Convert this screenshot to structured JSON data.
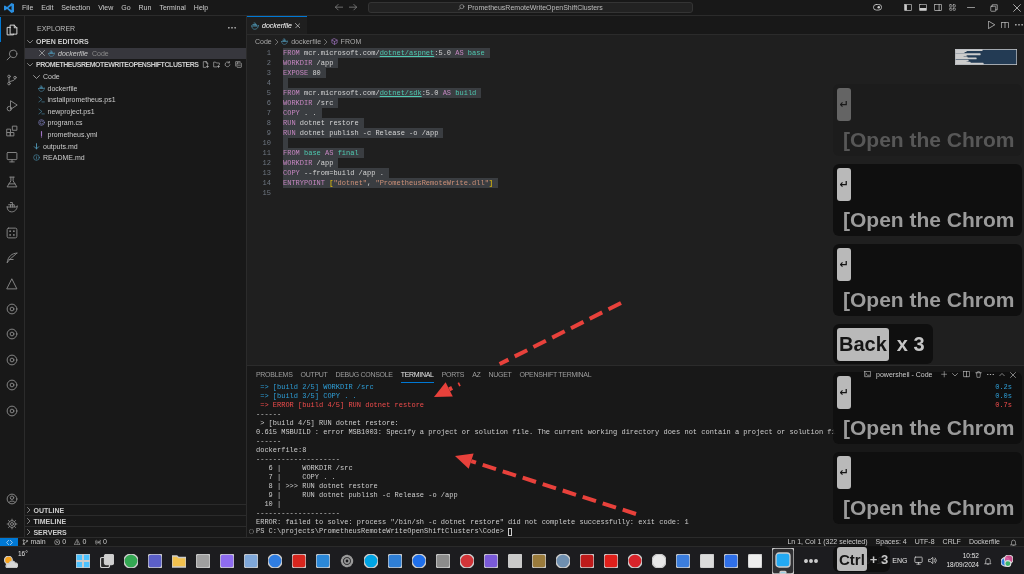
{
  "title_bar": {
    "menu": [
      "File",
      "Edit",
      "Selection",
      "View",
      "Go",
      "Run",
      "Terminal",
      "Help"
    ],
    "command_center": "PrometheusRemoteWriteOpenShiftClusters"
  },
  "activity_bar": {
    "items": [
      {
        "kind": "files",
        "selected": true
      },
      {
        "kind": "search",
        "selected": false
      },
      {
        "kind": "branch",
        "selected": false
      },
      {
        "kind": "debug",
        "selected": false
      },
      {
        "kind": "blocks",
        "selected": false
      },
      {
        "kind": "monitor",
        "selected": false
      },
      {
        "kind": "flask",
        "selected": false
      },
      {
        "kind": "whale",
        "selected": false
      },
      {
        "kind": "grid",
        "selected": false
      },
      {
        "kind": "feather",
        "selected": false
      },
      {
        "kind": "triangle",
        "selected": false
      },
      {
        "kind": "ring",
        "selected": false
      },
      {
        "kind": "ring",
        "selected": false
      },
      {
        "kind": "ring",
        "selected": false
      },
      {
        "kind": "ring",
        "selected": false
      },
      {
        "kind": "ring",
        "selected": false
      }
    ],
    "bottom": [
      {
        "kind": "account"
      },
      {
        "kind": "gear"
      }
    ]
  },
  "sidebar": {
    "title": "EXPLORER",
    "open_editors": {
      "label": "OPEN EDITORS",
      "expanded": true,
      "items": [
        {
          "name": "dockerfile",
          "detail": "Code",
          "kind": "docker",
          "selected": true,
          "preview": true
        }
      ]
    },
    "workspace": {
      "label": "PROMETHEUSREMOTEWRITEOPENSHIFTCLUSTERS",
      "expanded": true,
      "tree": [
        {
          "name": "Code",
          "kind": "folder",
          "expanded": true,
          "selected": false,
          "children": [
            {
              "name": "dockerfile",
              "kind": "docker",
              "selected": false
            },
            {
              "name": "installprometheus.ps1",
              "kind": "powershell",
              "selected": false
            },
            {
              "name": "newproject.ps1",
              "kind": "powershell",
              "selected": false
            },
            {
              "name": "program.cs",
              "kind": "csharp",
              "selected": false
            },
            {
              "name": "prometheus.yml",
              "kind": "yaml",
              "selected": false
            }
          ]
        },
        {
          "name": "outputs.md",
          "kind": "markdown",
          "selected": false
        },
        {
          "name": "README.md",
          "kind": "info",
          "selected": false
        }
      ]
    },
    "sections": [
      {
        "label": "OUTLINE",
        "expanded": false
      },
      {
        "label": "TIMELINE",
        "expanded": false
      },
      {
        "label": "SERVERS",
        "expanded": false
      }
    ]
  },
  "editor": {
    "tabs": [
      {
        "label": "dockerfile",
        "kind": "docker",
        "selected": true,
        "preview": true
      }
    ],
    "breadcrumb": [
      {
        "label": "Code",
        "kind": "folder"
      },
      {
        "label": "dockerfile",
        "kind": "docker"
      },
      {
        "label": "FROM",
        "kind": "symbol"
      }
    ],
    "lines": [
      {
        "number": "1",
        "selected": true,
        "tokens": [
          {
            "kind": "keyword",
            "text": "FROM"
          },
          {
            "kind": "text",
            "text": " mcr.microsoft.com/"
          },
          {
            "kind": "link",
            "text": "dotnet/aspnet"
          },
          {
            "kind": "text",
            "text": ":5.0 "
          },
          {
            "kind": "keyword",
            "text": "AS"
          },
          {
            "kind": "name",
            "text": " base"
          }
        ]
      },
      {
        "number": "2",
        "selected": true,
        "tokens": [
          {
            "kind": "keyword",
            "text": "WORKDIR"
          },
          {
            "kind": "text",
            "text": " /app"
          }
        ]
      },
      {
        "number": "3",
        "selected": true,
        "tokens": [
          {
            "kind": "keyword",
            "text": "EXPOSE"
          },
          {
            "kind": "text",
            "text": " 80"
          }
        ]
      },
      {
        "number": "4",
        "selected": true
      },
      {
        "number": "5",
        "selected": true,
        "tokens": [
          {
            "kind": "keyword",
            "text": "FROM"
          },
          {
            "kind": "text",
            "text": " mcr.microsoft.com/"
          },
          {
            "kind": "link",
            "text": "dotnet/sdk"
          },
          {
            "kind": "text",
            "text": ":5.0 "
          },
          {
            "kind": "keyword",
            "text": "AS"
          },
          {
            "kind": "name",
            "text": " build"
          }
        ]
      },
      {
        "number": "6",
        "selected": true,
        "tokens": [
          {
            "kind": "keyword",
            "text": "WORKDIR"
          },
          {
            "kind": "text",
            "text": " /src"
          }
        ]
      },
      {
        "number": "7",
        "selected": true,
        "tokens": [
          {
            "kind": "keyword",
            "text": "COPY"
          },
          {
            "kind": "text",
            "text": " . ."
          }
        ]
      },
      {
        "number": "8",
        "selected": true,
        "tokens": [
          {
            "kind": "keyword",
            "text": "RUN"
          },
          {
            "kind": "text",
            "text": " dotnet restore"
          }
        ]
      },
      {
        "number": "9",
        "selected": true,
        "tokens": [
          {
            "kind": "keyword",
            "text": "RUN"
          },
          {
            "kind": "text",
            "text": " dotnet publish -c Release -o /app"
          }
        ]
      },
      {
        "number": "10",
        "selected": true
      },
      {
        "number": "11",
        "selected": true,
        "tokens": [
          {
            "kind": "keyword",
            "text": "FROM"
          },
          {
            "kind": "name",
            "text": " base"
          },
          {
            "kind": "keyword",
            "text": " AS"
          },
          {
            "kind": "name",
            "text": " final"
          }
        ]
      },
      {
        "number": "12",
        "selected": true,
        "tokens": [
          {
            "kind": "keyword",
            "text": "WORKDIR"
          },
          {
            "kind": "text",
            "text": " /app"
          }
        ]
      },
      {
        "number": "13",
        "selected": true,
        "tokens": [
          {
            "kind": "keyword",
            "text": "COPY"
          },
          {
            "kind": "text",
            "text": " --from=build /app ."
          }
        ]
      },
      {
        "number": "14",
        "selected": true,
        "tokens": [
          {
            "kind": "keyword",
            "text": "ENTRYPOINT"
          },
          {
            "kind": "bracket",
            "text": " ["
          },
          {
            "kind": "string",
            "text": "\"dotnet\""
          },
          {
            "kind": "text",
            "text": ", "
          },
          {
            "kind": "string",
            "text": "\"PrometheusRemoteWrite.dll\""
          },
          {
            "kind": "bracket",
            "text": "]"
          }
        ]
      },
      {
        "number": "15",
        "selected": false
      }
    ]
  },
  "panel": {
    "tabs": [
      {
        "label": "PROBLEMS",
        "selected": false
      },
      {
        "label": "OUTPUT",
        "selected": false
      },
      {
        "label": "DEBUG CONSOLE",
        "selected": false
      },
      {
        "label": "TERMINAL",
        "selected": true
      },
      {
        "label": "PORTS",
        "selected": false
      },
      {
        "label": "AZ",
        "selected": false
      },
      {
        "label": "NUGET",
        "selected": false
      },
      {
        "label": "OPENSHIFT TERMINAL",
        "selected": false
      }
    ],
    "terminal": {
      "name": "powershell - Code",
      "lines": [
        {
          "kind": "step",
          "text": " => [build 2/5] WORKDIR /src",
          "time": "0.2s"
        },
        {
          "kind": "step",
          "text": " => [build 3/5] COPY . .",
          "time": "0.0s"
        },
        {
          "kind": "error",
          "text": " => ERROR [build 4/5] RUN dotnet restore",
          "time": "0.7s"
        },
        {
          "kind": "plain",
          "text": "------"
        },
        {
          "kind": "plain",
          "text": " > [build 4/5] RUN dotnet restore:"
        },
        {
          "kind": "plain",
          "text": "0.615 MSBUILD : error MSB1003: Specify a project or solution file. The current working directory does not contain a project or solution fi"
        },
        {
          "kind": "plain",
          "text": "------"
        },
        {
          "kind": "plain",
          "text": "dockerfile:8"
        },
        {
          "kind": "plain",
          "text": "--------------------"
        },
        {
          "kind": "plain",
          "text": "   6 |     WORKDIR /src"
        },
        {
          "kind": "plain",
          "text": "   7 |     COPY . ."
        },
        {
          "kind": "plain",
          "text": "   8 | >>> RUN dotnet restore"
        },
        {
          "kind": "plain",
          "text": "   9 |     RUN dotnet publish -c Release -o /app"
        },
        {
          "kind": "plain",
          "text": "  10 |"
        },
        {
          "kind": "plain",
          "text": "--------------------"
        },
        {
          "kind": "plain",
          "text": "ERROR: failed to solve: process \"/bin/sh -c dotnet restore\" did not complete successfully: exit code: 1"
        },
        {
          "kind": "prompt",
          "text": "PS C:\\projects\\PrometheusRemoteWriteOpenShiftClusters\\Code>"
        }
      ]
    }
  },
  "status_bar": {
    "left": [
      {
        "kind": "remote"
      },
      {
        "kind": "branch",
        "text": "main"
      },
      {
        "kind": "errors",
        "text": "0"
      },
      {
        "kind": "warnings",
        "text": "0"
      },
      {
        "kind": "ports",
        "text": "0"
      }
    ],
    "right": [
      {
        "kind": "text",
        "text": "Ln 1, Col 1 (322 selected)"
      },
      {
        "kind": "text",
        "text": "Spaces: 4"
      },
      {
        "kind": "text",
        "text": "UTF-8"
      },
      {
        "kind": "text",
        "text": "CRLF"
      },
      {
        "kind": "text",
        "text": "Dockerfile"
      },
      {
        "kind": "bell"
      }
    ]
  },
  "taskbar": {
    "weather": {
      "temperature": "16°"
    },
    "apps": [
      {
        "kind": "start",
        "color": "#4cc2ff",
        "active": false
      },
      {
        "kind": "taskview",
        "color": "#d0d0d0",
        "active": false
      },
      {
        "kind": "circle",
        "color": "#34a853",
        "active": false
      },
      {
        "kind": "tile",
        "color": "#5b5fc7",
        "active": false
      },
      {
        "kind": "folder",
        "color": "#f2c14e",
        "active": false
      },
      {
        "kind": "tile",
        "color": "#a0a0a0",
        "active": false
      },
      {
        "kind": "tile",
        "color": "#8e6cf0",
        "active": false
      },
      {
        "kind": "tile",
        "color": "#7fa7d9",
        "active": false
      },
      {
        "kind": "circle",
        "color": "#2f7de1",
        "active": false
      },
      {
        "kind": "tile",
        "color": "#d7261e",
        "active": false
      },
      {
        "kind": "tile",
        "color": "#2b88d8",
        "active": false
      },
      {
        "kind": "gear",
        "color": "#9a9a9a",
        "active": false
      },
      {
        "kind": "circle",
        "color": "#00a4e4",
        "active": false
      },
      {
        "kind": "tile",
        "color": "#2f7fd6",
        "active": false
      },
      {
        "kind": "circle",
        "color": "#1f6feb",
        "active": false
      },
      {
        "kind": "tile",
        "color": "#8c8c8c",
        "active": false
      },
      {
        "kind": "circle",
        "color": "#d13438",
        "active": false
      },
      {
        "kind": "tile",
        "color": "#7a5ad8",
        "active": false
      },
      {
        "kind": "tile",
        "color": "#c9c9c9",
        "active": false
      },
      {
        "kind": "tile",
        "color": "#9a7b3c",
        "active": false
      },
      {
        "kind": "circle",
        "color": "#6f8fb0",
        "active": false
      },
      {
        "kind": "tile",
        "color": "#bf1b1b",
        "active": false
      },
      {
        "kind": "tile",
        "color": "#e0201b",
        "active": false
      },
      {
        "kind": "circle",
        "color": "#d8232a",
        "active": false
      },
      {
        "kind": "circle",
        "color": "#e8e8e8",
        "active": false
      },
      {
        "kind": "tile",
        "color": "#3b7ddd",
        "active": false
      },
      {
        "kind": "tile",
        "color": "#dcdcdc",
        "active": false
      },
      {
        "kind": "tile",
        "color": "#2f6fe8",
        "active": false
      },
      {
        "kind": "tile",
        "color": "#eeeeee",
        "active": false
      },
      {
        "kind": "tile",
        "color": "#23a9f2",
        "active": true
      },
      {
        "kind": "more",
        "active": false
      }
    ],
    "tray": {
      "language": "ENG",
      "time": "10:52",
      "date": "18/09/2024"
    }
  },
  "keystroke_overlay": {
    "cards": [
      {
        "kind": "caption",
        "faded": true,
        "key": "↵",
        "caption": "[Open the Chrom"
      },
      {
        "kind": "caption",
        "faded": false,
        "key": "↵",
        "caption": "[Open the Chrom"
      },
      {
        "kind": "caption",
        "faded": false,
        "key": "↵",
        "caption": "[Open the Chrom"
      },
      {
        "kind": "count",
        "faded": false,
        "key": "Back",
        "count": "x 3"
      },
      {
        "kind": "caption",
        "faded": false,
        "key": "↵",
        "caption": "[Open the Chrom"
      },
      {
        "kind": "caption",
        "faded": false,
        "key": "↵",
        "caption": "[Open the Chrom"
      },
      {
        "kind": "count",
        "faded": false,
        "key": "Ctrl",
        "count": "+ 3"
      }
    ]
  },
  "annotations": [
    {
      "kind": "dashed-arrow"
    },
    {
      "kind": "dashed-arrow"
    }
  ]
}
